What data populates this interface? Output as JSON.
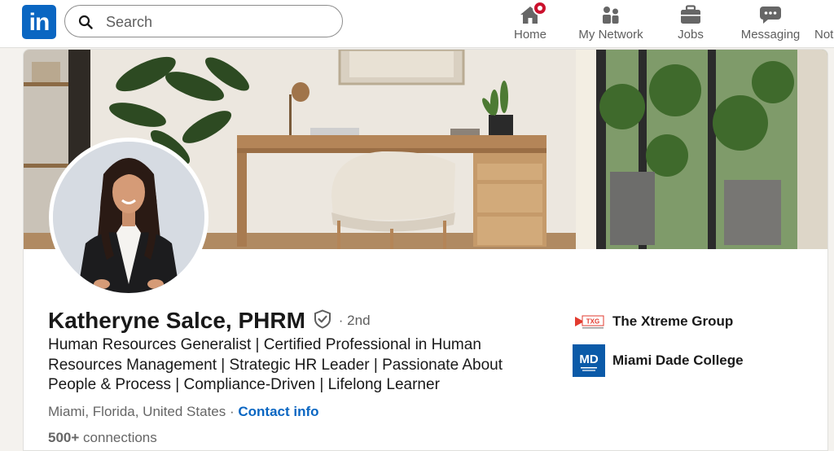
{
  "nav": {
    "logo_text": "in",
    "search_placeholder": "Search",
    "items": [
      {
        "label": "Home",
        "icon": "home-icon"
      },
      {
        "label": "My Network",
        "icon": "people-icon"
      },
      {
        "label": "Jobs",
        "icon": "briefcase-icon"
      },
      {
        "label": "Messaging",
        "icon": "chat-icon"
      },
      {
        "label": "Not",
        "icon": "bell-icon"
      }
    ],
    "home_has_notification": true
  },
  "profile": {
    "name": "Katheryne Salce, PHRM",
    "degree": "· 2nd",
    "headline": "Human Resources Generalist | Certified Professional in Human Resources Management | Strategic HR Leader | Passionate About People & Process | Compliance-Driven | Lifelong Learner",
    "location": "Miami, Florida, United States",
    "separator": "·",
    "contact_info": "Contact info",
    "connections_count": "500+",
    "connections_label": "connections",
    "organizations": [
      {
        "name": "The Xtreme Group",
        "logo_text": "TXG"
      },
      {
        "name": "Miami Dade College",
        "logo_text": "MD"
      }
    ]
  },
  "colors": {
    "brand": "#0a66c2",
    "badge": "#cb112d",
    "text_primary": "#191919",
    "text_secondary": "#5e5e5e",
    "background": "#f4f2ee"
  }
}
